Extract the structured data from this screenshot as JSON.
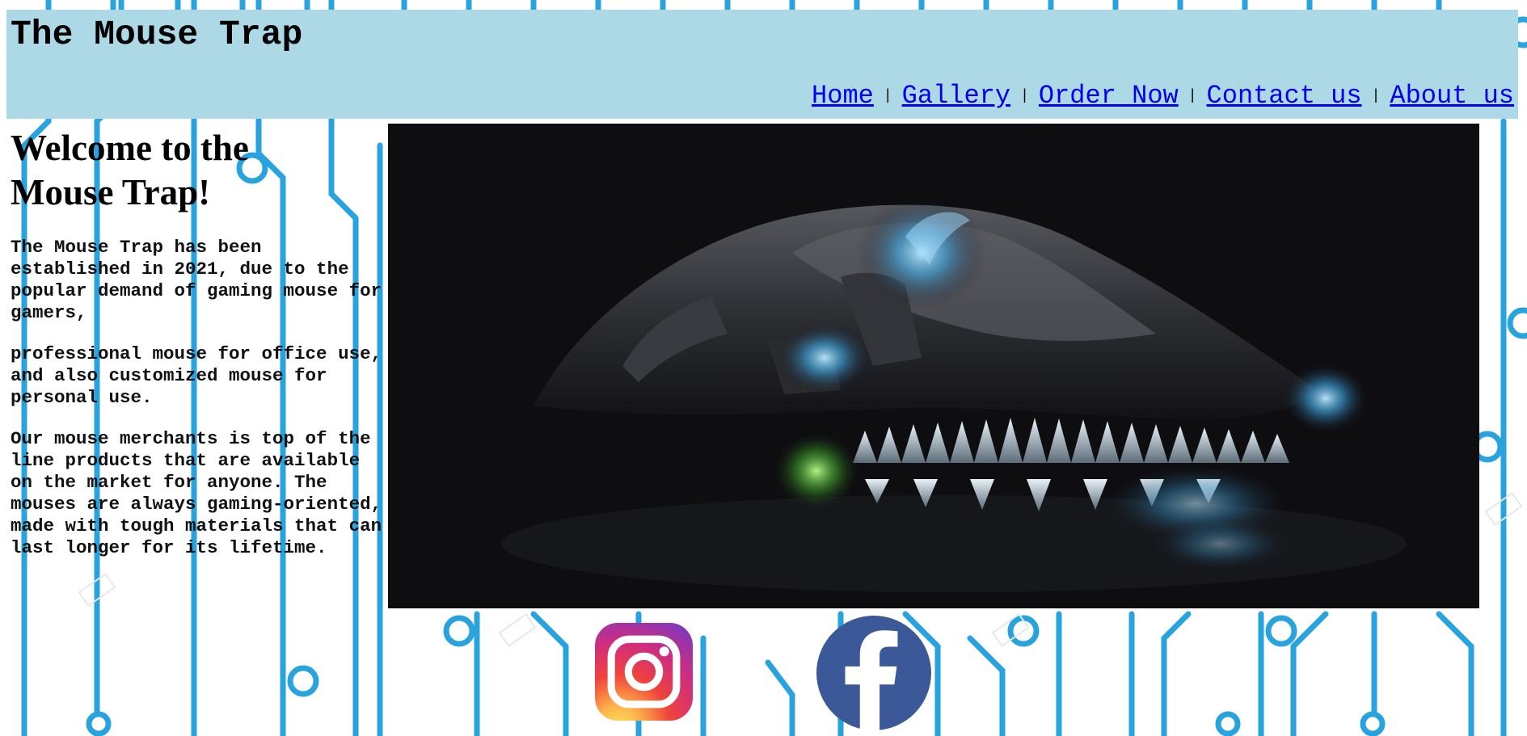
{
  "header": {
    "title": "The Mouse Trap",
    "background_color": "#add8e6"
  },
  "nav": {
    "separator": "|",
    "items": [
      {
        "label": "Home"
      },
      {
        "label": "Gallery"
      },
      {
        "label": "Order Now"
      },
      {
        "label": "Contact us"
      },
      {
        "label": "About us"
      }
    ],
    "link_color": "#0000ee"
  },
  "main": {
    "heading": "Welcome to the Mouse Trap!",
    "paragraphs": [
      "The Mouse Trap has been established in 2021, due to the popular demand of gaming mouse for gamers,",
      "professional mouse for office use, and also customized mouse for personal use.",
      "Our mouse merchants is top of the line products that are available on the market for anyone. The mouses are always gaming-oriented, made with tough materials that can last longer for its lifetime."
    ]
  },
  "hero": {
    "image_icon": "monster-gaming-mouse-image"
  },
  "social": {
    "instagram_icon": "instagram-icon",
    "facebook_icon": "facebook-icon"
  },
  "background": {
    "pattern": "circuit-board-pattern",
    "line_color": "#29a3dd"
  }
}
